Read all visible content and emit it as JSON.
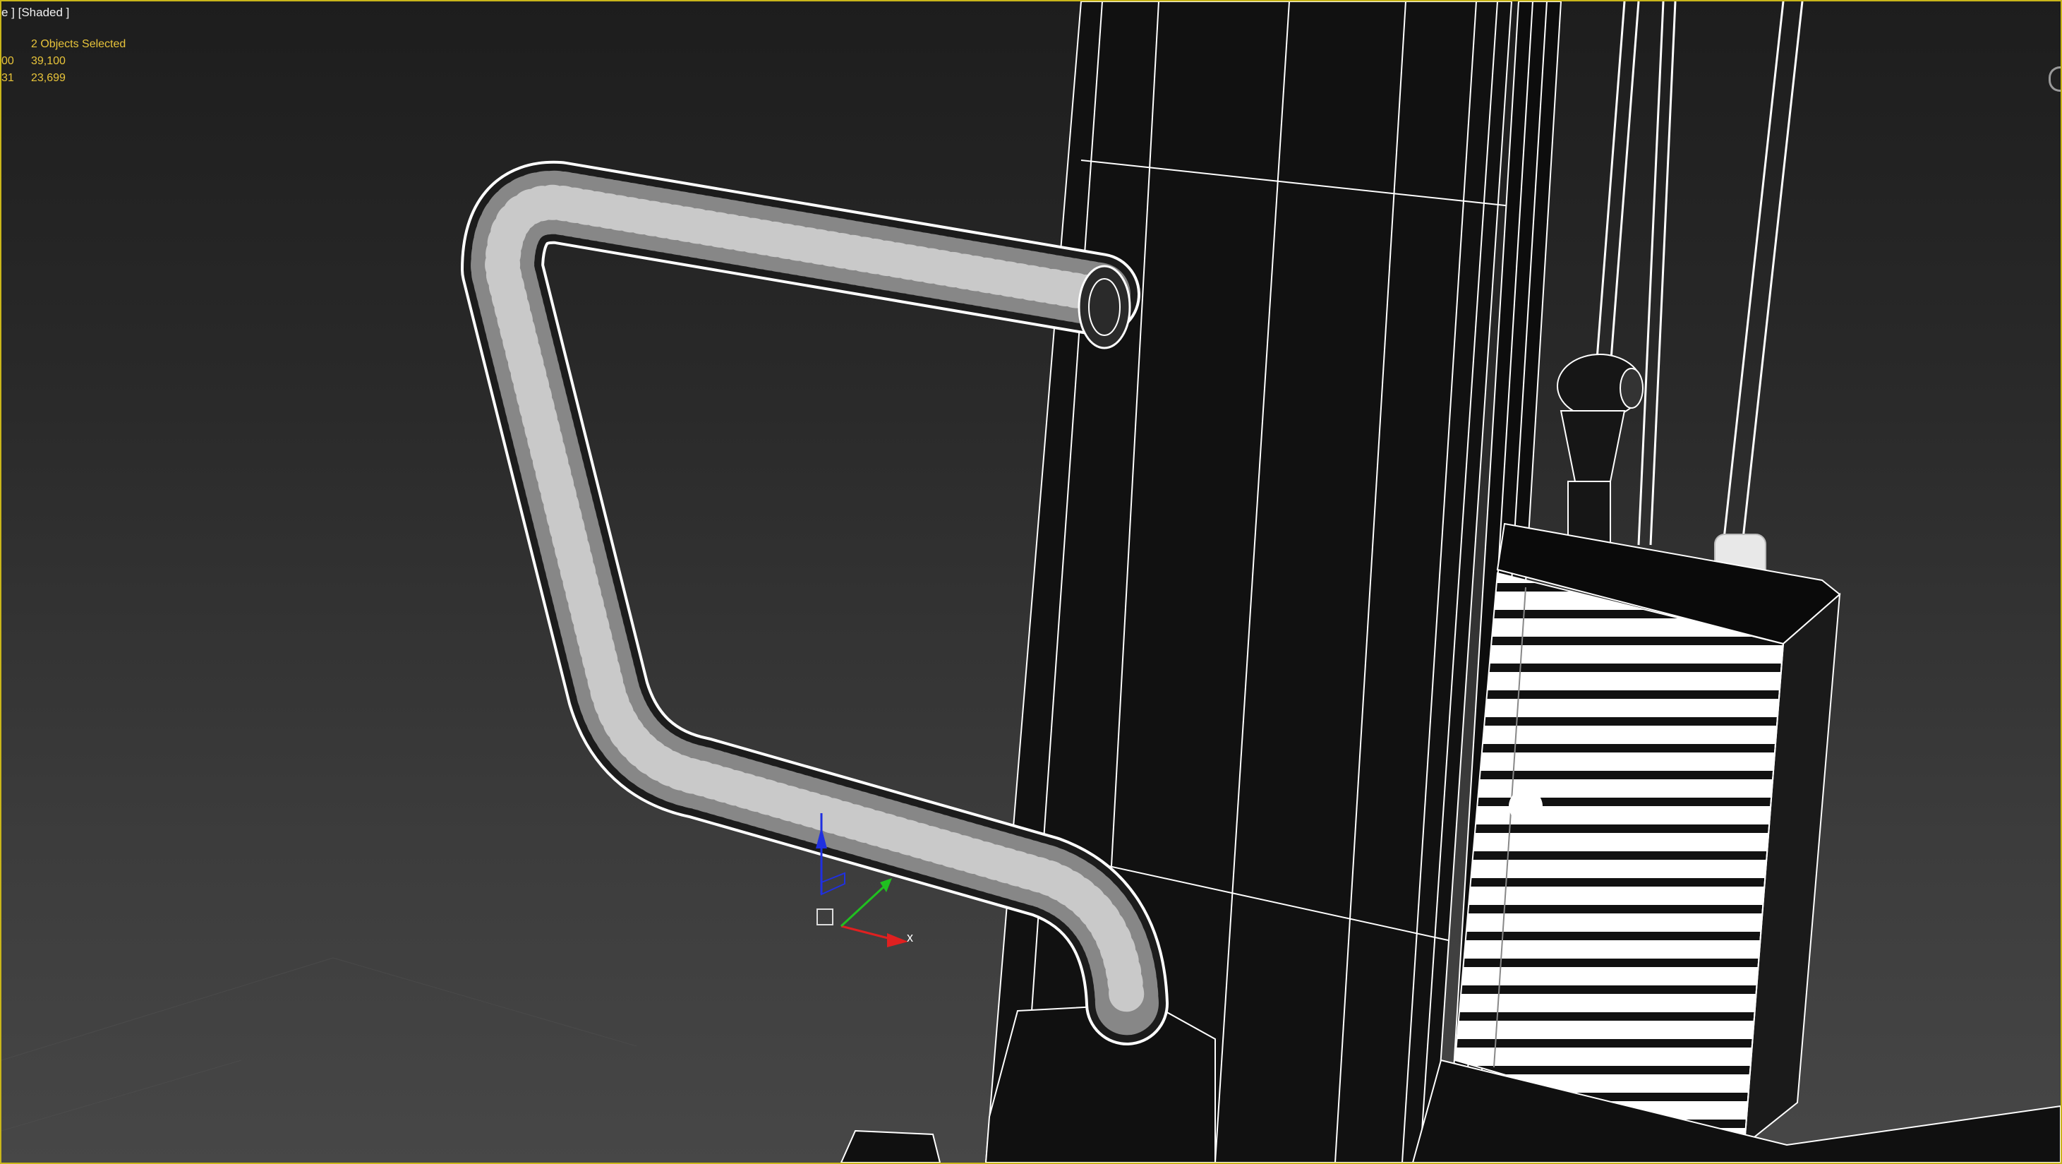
{
  "viewport": {
    "label": "e ] [Shaded ]",
    "stats": {
      "selection": "2 Objects Selected",
      "row1_left": "00",
      "row1_value": "39,100",
      "row2_left": "31",
      "row2_value": "23,699"
    }
  },
  "gizmo": {
    "x_label": "x",
    "colors": {
      "x": "#e02020",
      "y": "#20c020",
      "z": "#2030e0"
    }
  },
  "colors": {
    "viewport_border": "#c9b61a",
    "stats_text": "#e8c43a",
    "wire": "#ffffff"
  }
}
